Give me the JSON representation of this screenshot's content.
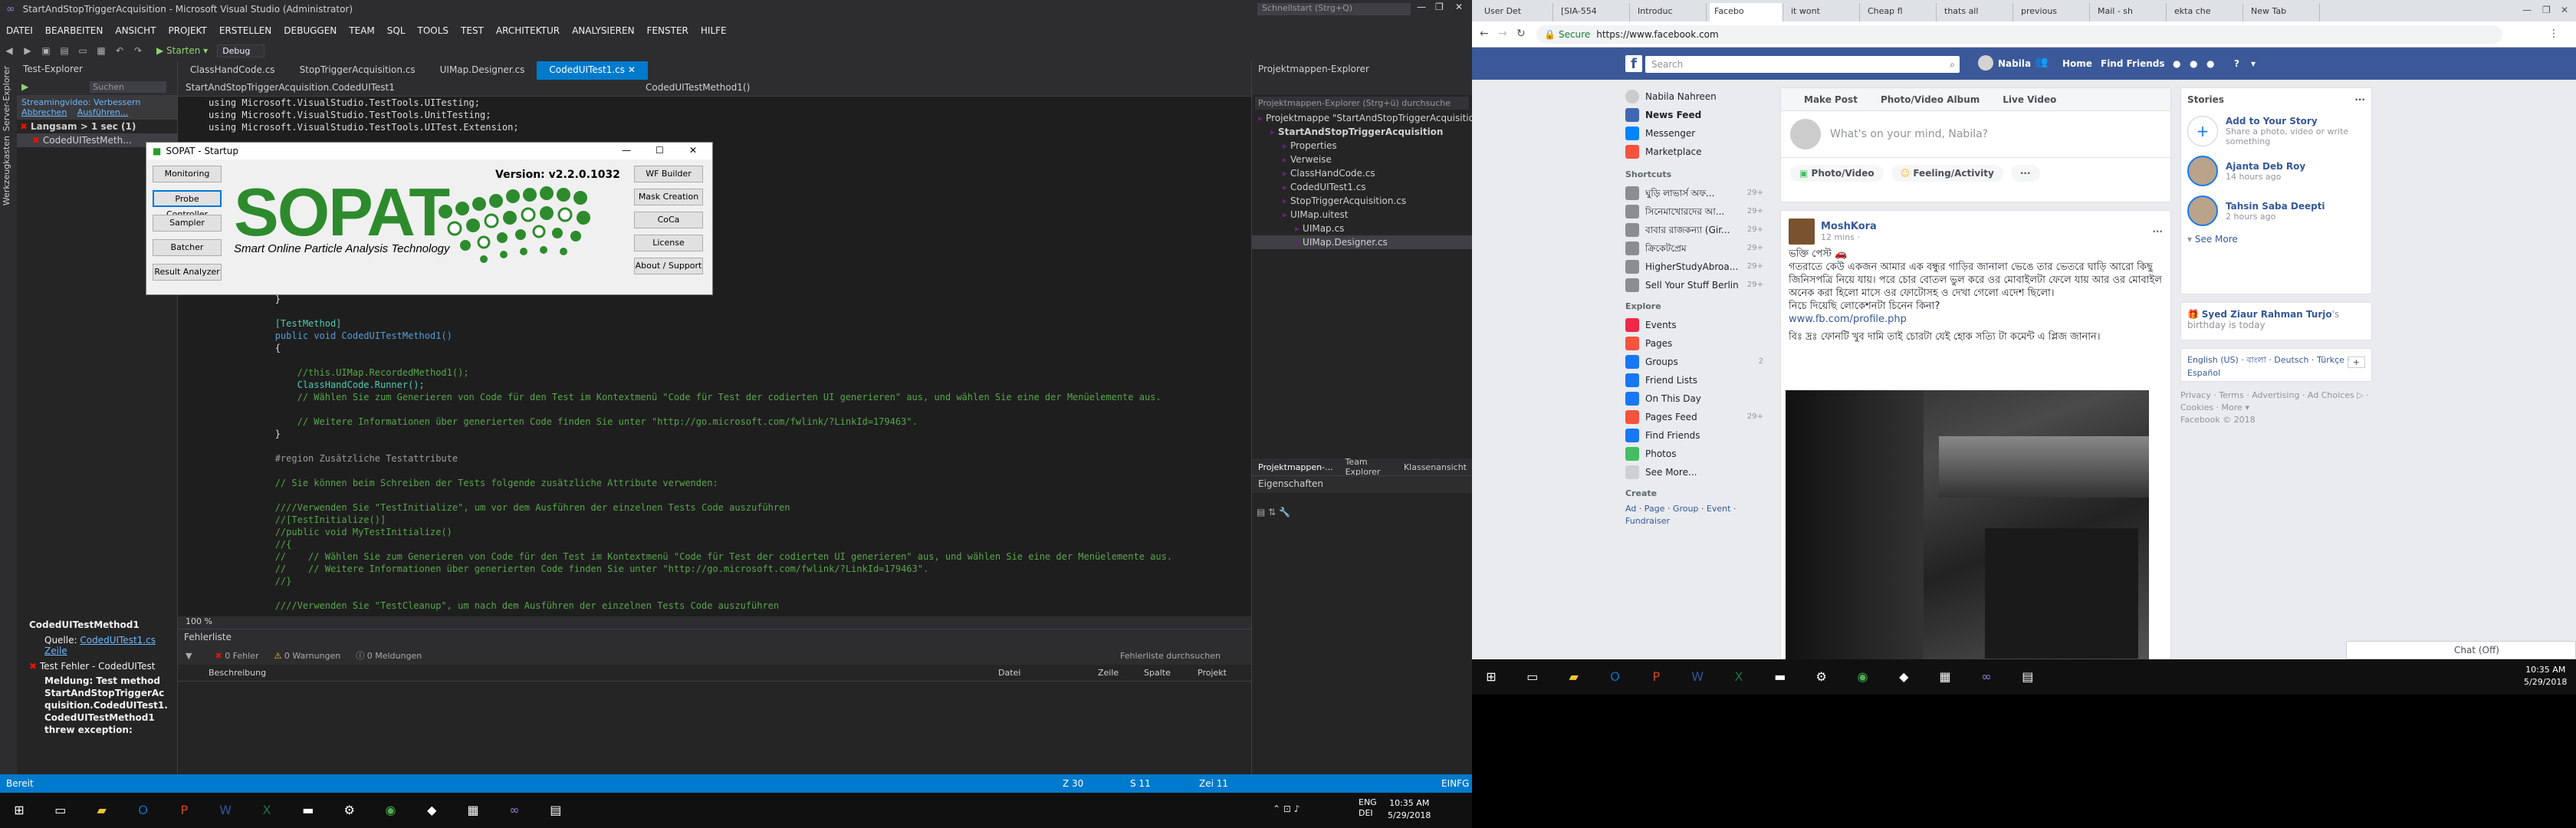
{
  "vs": {
    "title": "StartAndStopTriggerAcquisition - Microsoft Visual Studio (Administrator)",
    "quick_launch": "Schnellstart (Strg+Q)",
    "menu": [
      "DATEI",
      "BEARBEITEN",
      "ANSICHT",
      "PROJEKT",
      "ERSTELLEN",
      "DEBUGGEN",
      "TEAM",
      "SQL",
      "TOOLS",
      "TEST",
      "ARCHITEKTUR",
      "ANALYSIEREN",
      "FENSTER",
      "HILFE"
    ],
    "toolbar": {
      "start": "▶ Starten ▾",
      "config": "Debug"
    },
    "left_strip": [
      "Server-Explorer",
      "Werkzeugkasten"
    ],
    "test_explorer": {
      "title": "Test-Explorer",
      "search": "Suchen",
      "banner": "Streamingvideo: Verbessern",
      "banner_links": [
        "Abbrechen",
        "Ausführen..."
      ],
      "group": "Langsam > 1 sec (1)",
      "item": "CodedUITestMeth...",
      "detail_title": "CodedUITestMethod1",
      "detail_source_label": "Quelle:",
      "detail_source_link": "CodedUITest1.cs Zeile",
      "detail_error_head": "Test Fehler - CodedUITest",
      "detail_lines": [
        "Meldung: Test method",
        "StartAndStopTriggerAc",
        "quisition.CodedUITest1.",
        "CodedUITestMethod1",
        "threw exception:"
      ]
    },
    "editor": {
      "tabs": [
        "ClassHandCode.cs",
        "StopTriggerAcquisition.cs",
        "UIMap.Designer.cs",
        "CodedUITest1.cs"
      ],
      "nav_left": "StartAndStopTriggerAcquisition.CodedUITest1",
      "nav_right": "CodedUITestMethod1()",
      "zoom": "100 %",
      "lines": [
        {
          "cls": "tx",
          "t": "using Microsoft.VisualStudio.TestTools.UITesting;"
        },
        {
          "cls": "tx",
          "t": "using Microsoft.VisualStudio.TestTools.UnitTesting;"
        },
        {
          "cls": "tx",
          "t": "using Microsoft.VisualStudio.TestTools.UITest.Extension;"
        },
        {
          "cls": "tx",
          "t": ""
        },
        {
          "cls": "tx",
          "t": ""
        },
        {
          "cls": "tx",
          "t": ""
        },
        {
          "cls": "tx",
          "t": ""
        },
        {
          "cls": "tx",
          "t": ""
        },
        {
          "cls": "tx",
          "t": ""
        },
        {
          "cls": "tx",
          "t": ""
        },
        {
          "cls": "tx",
          "t": ""
        },
        {
          "cls": "tx",
          "t": ""
        },
        {
          "cls": "tx",
          "t": ""
        },
        {
          "cls": "tx",
          "t": ""
        },
        {
          "cls": "tx",
          "t": ""
        },
        {
          "cls": "tx",
          "t": ""
        },
        {
          "cls": "tx",
          "t": "            }"
        },
        {
          "cls": "tx",
          "t": ""
        },
        {
          "cls": "ty",
          "t": "            [TestMethod]"
        },
        {
          "cls": "kw",
          "t": "            public void CodedUITestMethod1()"
        },
        {
          "cls": "tx",
          "t": "            {"
        },
        {
          "cls": "tx",
          "t": ""
        },
        {
          "cls": "cm",
          "t": "                //this.UIMap.RecordedMethod1();"
        },
        {
          "cls": "ty",
          "t": "                ClassHandCode.Runner();"
        },
        {
          "cls": "cm",
          "t": "                // Wählen Sie zum Generieren von Code für den Test im Kontextmenü \"Code für Test der codierten UI generieren\" aus, und wählen Sie eine der Menüelemente aus."
        },
        {
          "cls": "tx",
          "t": ""
        },
        {
          "cls": "cm",
          "t": "                // Weitere Informationen über generierten Code finden Sie unter \"http://go.microsoft.com/fwlink/?LinkId=179463\"."
        },
        {
          "cls": "tx",
          "t": "            }"
        },
        {
          "cls": "tx",
          "t": ""
        },
        {
          "cls": "gr",
          "t": "            #region Zusätzliche Testattribute"
        },
        {
          "cls": "tx",
          "t": ""
        },
        {
          "cls": "cm",
          "t": "            // Sie können beim Schreiben der Tests folgende zusätzliche Attribute verwenden:"
        },
        {
          "cls": "tx",
          "t": ""
        },
        {
          "cls": "cm",
          "t": "            ////Verwenden Sie \"TestInitialize\", um vor dem Ausführen der einzelnen Tests Code auszuführen"
        },
        {
          "cls": "cm",
          "t": "            //[TestInitialize()]"
        },
        {
          "cls": "cm",
          "t": "            //public void MyTestInitialize()"
        },
        {
          "cls": "cm",
          "t": "            //{"
        },
        {
          "cls": "cm",
          "t": "            //    // Wählen Sie zum Generieren von Code für den Test im Kontextmenü \"Code für Test der codierten UI generieren\" aus, und wählen Sie eine der Menüelemente aus."
        },
        {
          "cls": "cm",
          "t": "            //    // Weitere Informationen über generierten Code finden Sie unter \"http://go.microsoft.com/fwlink/?LinkId=179463\"."
        },
        {
          "cls": "cm",
          "t": "            //}"
        },
        {
          "cls": "tx",
          "t": ""
        },
        {
          "cls": "cm",
          "t": "            ////Verwenden Sie \"TestCleanup\", um nach dem Ausführen der einzelnen Tests Code auszuführen"
        }
      ]
    },
    "errors": {
      "title": "Fehlerliste",
      "errors": "0 Fehler",
      "warnings": "0 Warnungen",
      "messages": "0 Meldungen",
      "search": "Fehlerliste durchsuchen",
      "cols": [
        "Beschreibung",
        "Datei",
        "Zeile",
        "Spalte",
        "Projekt"
      ]
    },
    "solution": {
      "title": "Projektmappen-Explorer",
      "search": "Projektmappen-Explorer (Strg+ü) durchsuche",
      "items": [
        {
          "indent": 0,
          "t": "Projektmappe \"StartAndStopTriggerAcquisition\""
        },
        {
          "indent": 1,
          "t": "StartAndStopTriggerAcquisition",
          "bold": true
        },
        {
          "indent": 2,
          "t": "Properties"
        },
        {
          "indent": 2,
          "t": "Verweise"
        },
        {
          "indent": 2,
          "t": "ClassHandCode.cs"
        },
        {
          "indent": 2,
          "t": "CodedUITest1.cs"
        },
        {
          "indent": 2,
          "t": "StopTriggerAcquisition.cs"
        },
        {
          "indent": 2,
          "t": "UIMap.uitest"
        },
        {
          "indent": 3,
          "t": "UIMap.cs"
        },
        {
          "indent": 3,
          "t": "UIMap.Designer.cs",
          "selected": true
        }
      ],
      "bottom_tabs": [
        "Projektmappen-...",
        "Team Explorer",
        "Klassenansicht"
      ]
    },
    "props": {
      "title": "Eigenschaften"
    },
    "status": {
      "left": "Bereit",
      "z": "Z 30",
      "s": "S 11",
      "zei": "Zei 11",
      "mode": "EINFG"
    },
    "sopat": {
      "title": "SOPAT - Startup",
      "logo": "SOPAT",
      "tagline": "Smart Online Particle Analysis Technology",
      "version": "Version: v2.2.0.1032",
      "left_buttons": [
        "Monitoring",
        "Probe Controller",
        "Sampler",
        "Batcher",
        "Result Analyzer"
      ],
      "right_buttons": [
        "WF Builder",
        "Mask Creation",
        "CoCa",
        "License",
        "About / Support"
      ]
    },
    "taskbar": {
      "lang": "ENG\nDEI",
      "time": "10:35 AM",
      "date": "5/29/2018"
    }
  },
  "chrome": {
    "tabs": [
      "User Det",
      "[SIA-554",
      "Introduc",
      "Facebo",
      "it wont",
      "Cheap fl",
      "thats all",
      "previous",
      "Mail - sh",
      "ekta che",
      "New Tab"
    ],
    "active_tab": 3,
    "secure": "Secure",
    "url": "https://www.facebook.com",
    "fb": {
      "search": "Search",
      "user": "Nabila",
      "home": "Home",
      "find_friends": "Find Friends",
      "left_user": "Nabila Nahreen",
      "left_main": [
        {
          "t": "News Feed",
          "c": "#4267b2"
        },
        {
          "t": "Messenger",
          "c": "#0084ff"
        },
        {
          "t": "Marketplace",
          "c": "#f5533d"
        }
      ],
      "shortcuts_title": "Shortcuts",
      "shortcuts": [
        {
          "t": "ঘুড়ি লাভার্স অফ...",
          "n": "29+"
        },
        {
          "t": "সিনেমাখোরদের আ...",
          "n": "29+"
        },
        {
          "t": "বাবার রাজকন্যা (Gir...",
          "n": "29+"
        },
        {
          "t": "ক্রিকেটপ্রেম",
          "n": "29+"
        },
        {
          "t": "HigherStudyAbroa...",
          "n": "29+"
        },
        {
          "t": "Sell Your Stuff Berlin",
          "n": "29+"
        }
      ],
      "explore_title": "Explore",
      "explore": [
        {
          "t": "Events",
          "c": "#f02849"
        },
        {
          "t": "Pages",
          "c": "#f5533d"
        },
        {
          "t": "Groups",
          "c": "#1877f2",
          "n": "2"
        },
        {
          "t": "Friend Lists",
          "c": "#1877f2"
        },
        {
          "t": "On This Day",
          "c": "#1877f2"
        },
        {
          "t": "Pages Feed",
          "c": "#f5533d",
          "n": "29+"
        },
        {
          "t": "Find Friends",
          "c": "#1877f2"
        },
        {
          "t": "Photos",
          "c": "#45bd62"
        },
        {
          "t": "See More...",
          "c": "#ccd0d5"
        }
      ],
      "create_title": "Create",
      "create_links": "Ad · Page · Group · Event · Fundraiser",
      "composer_tabs": [
        "Make Post",
        "Photo/Video Album",
        "Live Video"
      ],
      "composer_placeholder": "What's on your mind, Nabila?",
      "composer_buttons": [
        "Photo/Video",
        "Feeling/Activity",
        "···"
      ],
      "post": {
        "author": "MoshKora",
        "time": "12 mins · ",
        "text1": "ভক্তি পেস্ট 🚗",
        "text2": "গতরাতে কেউ একজন আমার এক বন্ধুর গাড়ির জানালা ভেঙে তার ভেতরে ঘাড়ি আরো কিছু জিনিসপত্রি নিয়ে যায়। পরে চোর বোতল ভুল করে ওর মোবাইলটা ফেলে যায় আর ওর মোবাইল অনেক করা হিলো মাসে ওর ফোটোসহ ও দেখা গেলো এদেশ ছিলো।",
        "text3": "নিচে দিয়েছি লোকেশনটা চিনেন কিনা?",
        "link": "www.fb.com/profile.php",
        "text4": "বিঃ দ্রঃ ফোনটি খুব দামি তাই চোরটা যেই হোক সত্যি টা কমেন্ট এ প্লিজ জানান।"
      },
      "stories_title": "Stories",
      "stories_seeall": "See All",
      "add_story": "Add to Your Story",
      "add_story_sub": "Share a photo, video or write something",
      "stories": [
        {
          "name": "Ajanta Deb Roy",
          "time": "14 hours ago"
        },
        {
          "name": "Tahsin Saba Deepti",
          "time": "2 hours ago"
        }
      ],
      "see_more": "See More",
      "birthday_name": "Syed Ziaur Rahman Turjo",
      "birthday_rest": "'s birthday is today",
      "langs": "English (US) · বাংলা · Deutsch · Türkçe · Español",
      "footer": "Privacy · Terms · Advertising · Ad Choices ▷ · Cookies · More ▾",
      "copyright": "Facebook © 2018",
      "chat": "Chat (Off)"
    }
  },
  "taskbar_r": {
    "time": "10:35 AM",
    "date": "5/29/2018"
  }
}
